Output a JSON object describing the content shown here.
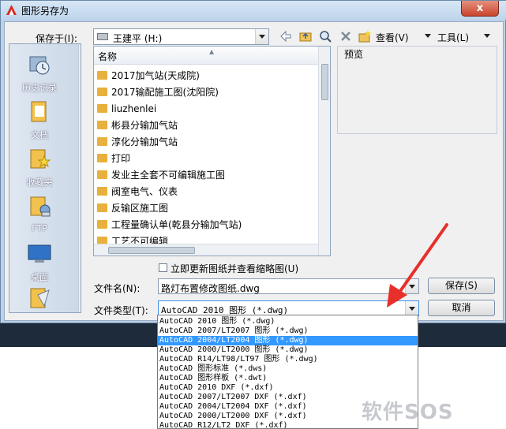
{
  "window": {
    "title": "图形另存为",
    "close_glyph": "x"
  },
  "toolbar": {
    "save_in_label": "保存于(I):",
    "save_in_value": "王建平 (H:)",
    "view_label": "查看(V)",
    "tools_label": "工具(L)"
  },
  "places": [
    {
      "label": "历史记录",
      "icon": "history-icon"
    },
    {
      "label": "文档",
      "icon": "documents-icon"
    },
    {
      "label": "收藏夹",
      "icon": "favorites-icon"
    },
    {
      "label": "FTP",
      "icon": "ftp-icon"
    },
    {
      "label": "桌面",
      "icon": "desktop-icon"
    }
  ],
  "filelist": {
    "header": "名称",
    "items": [
      "2017加气站(天成院)",
      "2017输配施工图(沈阳院)",
      "liuzhenlei",
      "彬县分输加气站",
      "淳化分输加气站",
      "打印",
      "发业主全套不可编辑施工图",
      "阀室电气、仪表",
      "反输区施工图",
      "工程量确认单(乾县分输加气站)",
      "工艺不可编辑"
    ]
  },
  "preview": {
    "label": "预览"
  },
  "checkbox": {
    "label": "立即更新图纸并查看缩略图(U)",
    "checked": false
  },
  "filename": {
    "label": "文件名(N):",
    "value": "路灯布置修改图纸.dwg"
  },
  "filetype": {
    "label": "文件类型(T):",
    "value": "AutoCAD 2010 图形 (*.dwg)",
    "options": [
      "AutoCAD 2010 图形 (*.dwg)",
      "AutoCAD 2007/LT2007 图形 (*.dwg)",
      "AutoCAD 2004/LT2004 图形 (*.dwg)",
      "AutoCAD 2000/LT2000 图形 (*.dwg)",
      "AutoCAD R14/LT98/LT97 图形 (*.dwg)",
      "AutoCAD 图形标准 (*.dws)",
      "AutoCAD 图形样板 (*.dwt)",
      "AutoCAD 2010 DXF (*.dxf)",
      "AutoCAD 2007/LT2007 DXF (*.dxf)",
      "AutoCAD 2004/LT2004 DXF (*.dxf)",
      "AutoCAD 2000/LT2000 DXF (*.dxf)",
      "AutoCAD R12/LT2 DXF (*.dxf)"
    ],
    "selected_index": 2
  },
  "buttons": {
    "save": "保存(S)",
    "cancel": "取消"
  },
  "watermark": "软件SOS",
  "colors": {
    "selection": "#3399ff",
    "annotation_arrow": "#e8302a"
  }
}
